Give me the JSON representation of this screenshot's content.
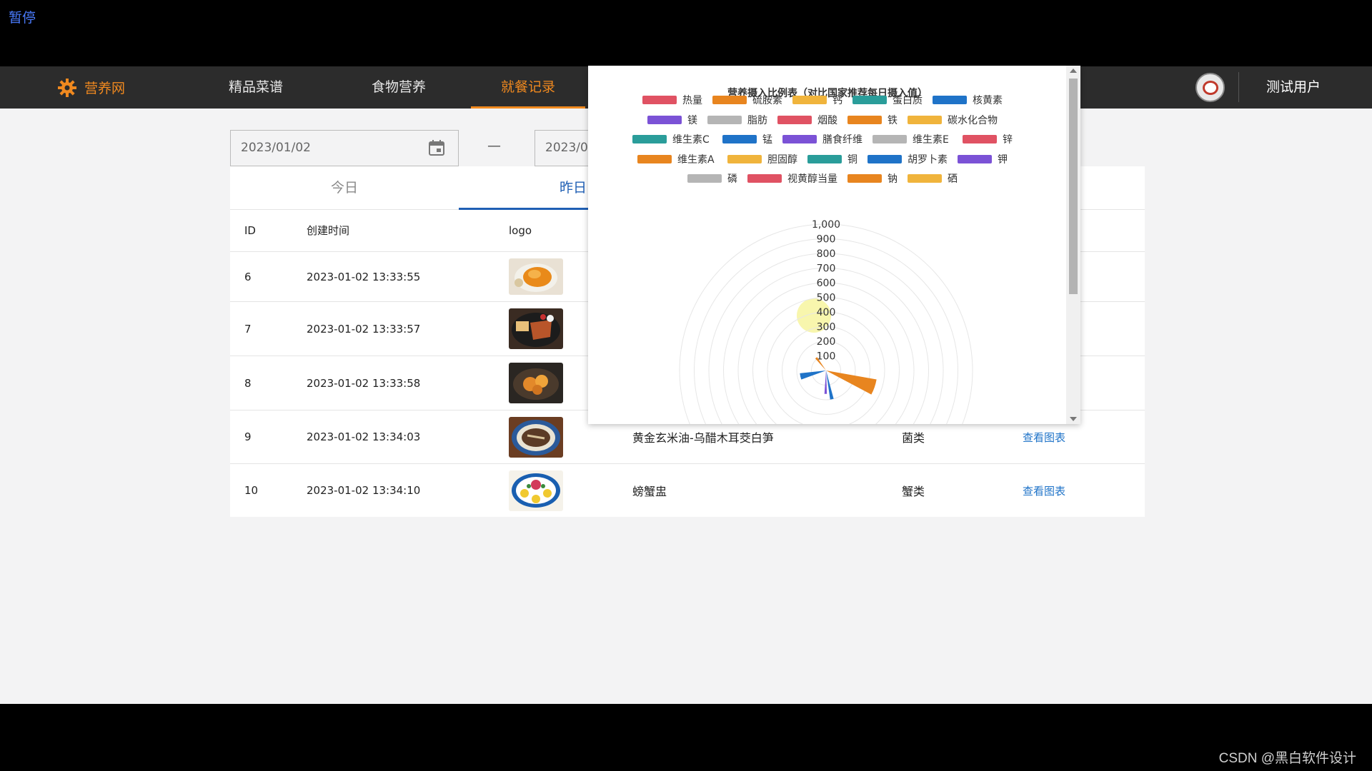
{
  "player": {
    "pause_label": "暂停"
  },
  "nav": {
    "brand": "营养网",
    "items": [
      {
        "label": "精品菜谱"
      },
      {
        "label": "食物营养"
      },
      {
        "label": "就餐记录"
      }
    ],
    "user_name": "测试用户"
  },
  "filter": {
    "start_date": "2023/01/02",
    "separator": "—",
    "end_date": "2023/0"
  },
  "tabs": [
    {
      "label": "今日"
    },
    {
      "label": "昨日"
    }
  ],
  "table": {
    "columns": [
      "ID",
      "创建时间",
      "logo"
    ],
    "rows": [
      {
        "id": "6",
        "time": "2023-01-02 13:33:55",
        "name": "",
        "type": "",
        "action": ""
      },
      {
        "id": "7",
        "time": "2023-01-02 13:33:57",
        "name": "",
        "type": "",
        "action": ""
      },
      {
        "id": "8",
        "time": "2023-01-02 13:33:58",
        "name": "",
        "type": "",
        "action": ""
      },
      {
        "id": "9",
        "time": "2023-01-02 13:34:03",
        "name": "黄金玄米油-乌醋木耳茭白笋",
        "type": "菌类",
        "action": "查看图表"
      },
      {
        "id": "10",
        "time": "2023-01-02 13:34:10",
        "name": "螃蟹盅",
        "type": "蟹类",
        "action": "查看图表"
      }
    ]
  },
  "chart_data": {
    "type": "bar",
    "subtype": "polar",
    "title": "营养摄入比例表（对比国家推荐每日摄入值）",
    "legend": [
      "热量",
      "硫胺素",
      "钙",
      "蛋白质",
      "核黄素",
      "镁",
      "脂肪",
      "烟酸",
      "铁",
      "碳水化合物",
      "维生素C",
      "锰",
      "膳食纤维",
      "维生素E",
      "锌",
      "维生素A",
      "胆固醇",
      "铜",
      "胡罗卜素",
      "钾",
      "磷",
      "视黄醇当量",
      "钠",
      "硒"
    ],
    "legend_colors": [
      "#e05263",
      "#e8851f",
      "#f0b43c",
      "#2a9d9a",
      "#1f73c8",
      "#7b52d6",
      "#b5b5b5",
      "#e05263",
      "#e8851f",
      "#f0b43c",
      "#2a9d9a",
      "#1f73c8",
      "#7b52d6",
      "#b5b5b5",
      "#e05263",
      "#e8851f",
      "#f0b43c",
      "#2a9d9a",
      "#1f73c8",
      "#7b52d6",
      "#b5b5b5",
      "#e05263",
      "#e8851f",
      "#f0b43c"
    ],
    "radial_ticks": [
      "1,000",
      "900",
      "800",
      "700",
      "600",
      "500",
      "400",
      "300",
      "200",
      "100"
    ],
    "ylim": [
      0,
      1000
    ],
    "visible_sectors": [
      {
        "series": "硫胺素",
        "value": 110,
        "color": "#e8851f"
      },
      {
        "series": "核黄素",
        "value": 180,
        "color": "#1f73c8"
      },
      {
        "series": "硫胺素",
        "value": 350,
        "color": "#e8851f"
      },
      {
        "series": "核黄素",
        "value": 200,
        "color": "#1f73c8"
      },
      {
        "series": "镁",
        "value": 160,
        "color": "#7b52d6"
      }
    ]
  },
  "watermark": "CSDN @黑白软件设计",
  "colors": {
    "accent_orange": "#f0891f",
    "link_blue": "#1f73c8",
    "tab_blue": "#1f5fb4",
    "nav_bg": "#2c2c2c"
  },
  "icons": {
    "brand": "gear-icon",
    "date": "calendar-icon",
    "avatar": "user-avatar"
  }
}
